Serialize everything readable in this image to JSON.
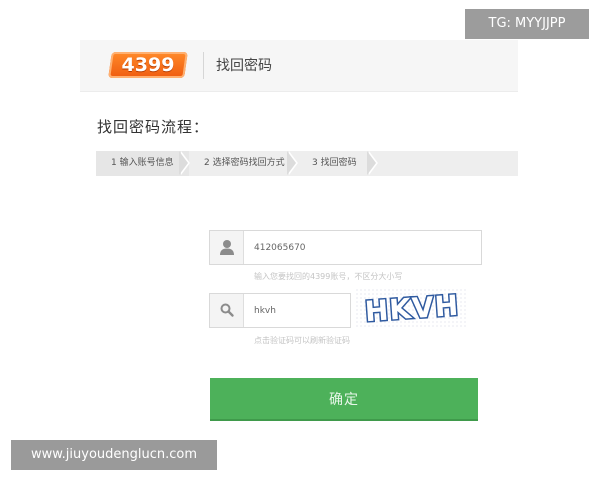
{
  "header": {
    "logo_text": "4399",
    "title": "找回密码"
  },
  "page": {
    "section_title": "找回密码流程："
  },
  "steps": [
    {
      "label": "1 输入账号信息"
    },
    {
      "label": "2 选择密码找回方式"
    },
    {
      "label": "3 找回密码"
    }
  ],
  "form": {
    "account_value": "412065670",
    "account_hint": "输入您要找回的4399账号，不区分大小写",
    "captcha_value": "hkvh",
    "captcha_text": "HKVH",
    "captcha_hint": "点击验证码可以刷新验证码",
    "submit_label": "确定"
  },
  "watermarks": {
    "tg": "TG: MYYJJPP",
    "url": "www.jiuyoudenglucn.com"
  },
  "colors": {
    "logo": "#f06a1a",
    "submit": "#4db15a",
    "captcha": "#2f5aa0"
  },
  "icons": {
    "account": "user-icon",
    "captcha": "search-icon"
  }
}
